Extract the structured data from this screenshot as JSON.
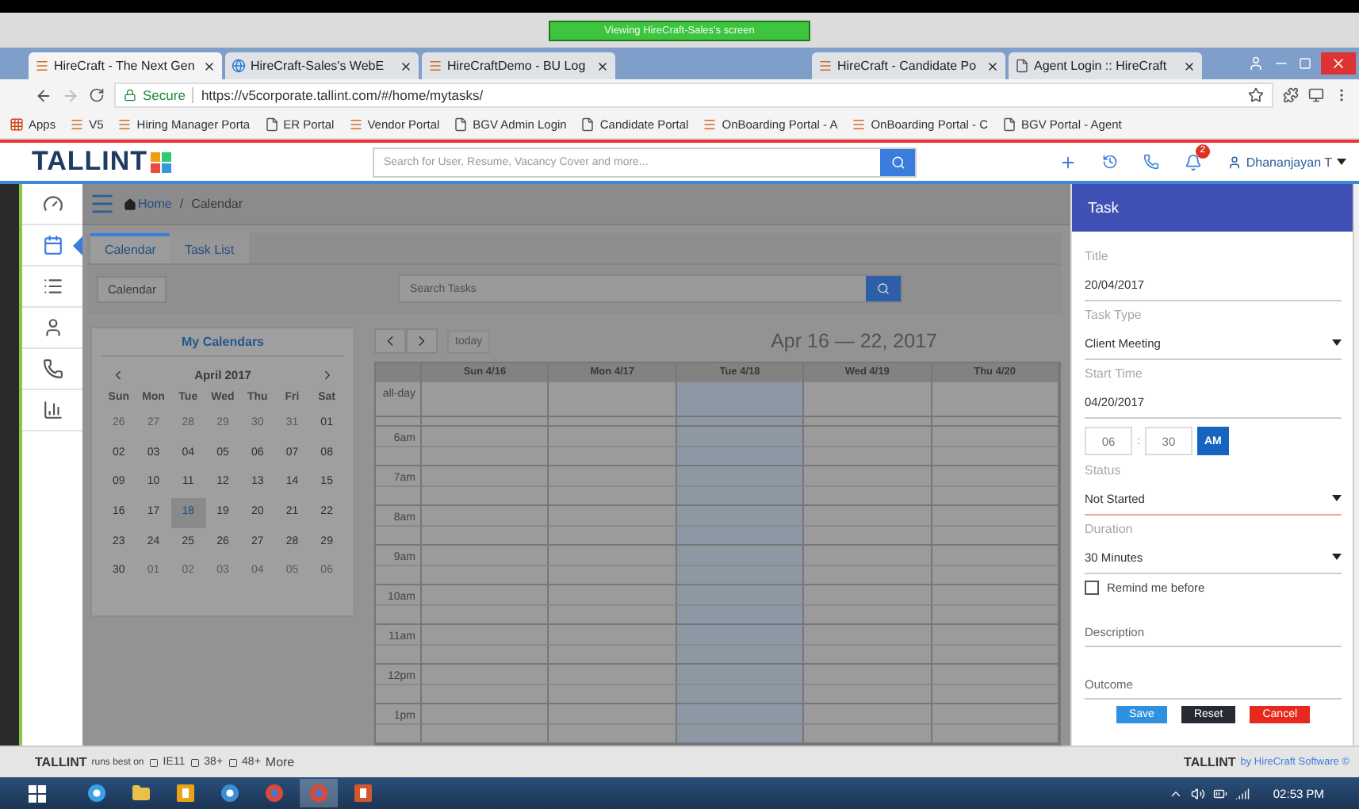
{
  "screen_share": {
    "banner": "Viewing HireCraft-Sales's screen"
  },
  "browser": {
    "tabs": [
      {
        "title": "HireCraft - The Next Gen",
        "kind": "site",
        "selected": true
      },
      {
        "title": "HireCraft-Sales's WebE",
        "kind": "globe",
        "selected": false
      },
      {
        "title": "HireCraftDemo - BU Log",
        "kind": "site",
        "selected": false
      },
      {
        "title": "HireCraft - Candidate Po",
        "kind": "site",
        "selected": false
      },
      {
        "title": "Agent Login :: HireCraft",
        "kind": "page",
        "selected": false
      }
    ],
    "secure_label": "Secure",
    "url": "https://v5corporate.tallint.com/#/home/mytasks/",
    "bookmarks": [
      {
        "label": "Apps",
        "kind": "apps"
      },
      {
        "label": "V5",
        "kind": "site"
      },
      {
        "label": "Hiring Manager Porta",
        "kind": "site"
      },
      {
        "label": "ER Portal",
        "kind": "page"
      },
      {
        "label": "Vendor Portal",
        "kind": "site"
      },
      {
        "label": "BGV Admin Login",
        "kind": "page"
      },
      {
        "label": "Candidate Portal",
        "kind": "page"
      },
      {
        "label": "OnBoarding Portal - A",
        "kind": "site"
      },
      {
        "label": "OnBoarding Portal - C",
        "kind": "site"
      },
      {
        "label": "BGV Portal - Agent",
        "kind": "page"
      }
    ]
  },
  "header": {
    "logo": "TALLINT",
    "search_placeholder": "Search for User, Resume, Vacancy Cover and more...",
    "notification_count": "2",
    "user": "Dhananjayan T"
  },
  "sidebar": {
    "items": [
      {
        "kind": "dashboard",
        "selected": false
      },
      {
        "kind": "calendar",
        "selected": true
      },
      {
        "kind": "list",
        "selected": false
      },
      {
        "kind": "user",
        "selected": false
      },
      {
        "kind": "phone",
        "selected": false
      },
      {
        "kind": "chart",
        "selected": false
      }
    ]
  },
  "breadcrumb": [
    "Home",
    "Calendar"
  ],
  "breadcrumb_separator": "/",
  "tabs": [
    {
      "label": "Calendar",
      "selected": true
    },
    {
      "label": "Task List",
      "selected": false
    }
  ],
  "toolbar": {
    "button": "Calendar",
    "search_placeholder": "Search Tasks"
  },
  "mini_calendar": {
    "title": "My Calendars",
    "month": "April 2017",
    "weekdays": [
      "Sun",
      "Mon",
      "Tue",
      "Wed",
      "Thu",
      "Fri",
      "Sat"
    ],
    "weeks": [
      [
        {
          "label": "26",
          "outside": true,
          "selected": false
        },
        {
          "label": "27",
          "outside": true,
          "selected": false
        },
        {
          "label": "28",
          "outside": true,
          "selected": false
        },
        {
          "label": "29",
          "outside": true,
          "selected": false
        },
        {
          "label": "30",
          "outside": true,
          "selected": false
        },
        {
          "label": "31",
          "outside": true,
          "selected": false
        },
        {
          "label": "01",
          "outside": false,
          "selected": false
        }
      ],
      [
        {
          "label": "02",
          "outside": false,
          "selected": false
        },
        {
          "label": "03",
          "outside": false,
          "selected": false
        },
        {
          "label": "04",
          "outside": false,
          "selected": false
        },
        {
          "label": "05",
          "outside": false,
          "selected": false
        },
        {
          "label": "06",
          "outside": false,
          "selected": false
        },
        {
          "label": "07",
          "outside": false,
          "selected": false
        },
        {
          "label": "08",
          "outside": false,
          "selected": false
        }
      ],
      [
        {
          "label": "09",
          "outside": false,
          "selected": false
        },
        {
          "label": "10",
          "outside": false,
          "selected": false
        },
        {
          "label": "11",
          "outside": false,
          "selected": false
        },
        {
          "label": "12",
          "outside": false,
          "selected": false
        },
        {
          "label": "13",
          "outside": false,
          "selected": false
        },
        {
          "label": "14",
          "outside": false,
          "selected": false
        },
        {
          "label": "15",
          "outside": false,
          "selected": false
        }
      ],
      [
        {
          "label": "16",
          "outside": false,
          "selected": false
        },
        {
          "label": "17",
          "outside": false,
          "selected": false
        },
        {
          "label": "18",
          "outside": false,
          "selected": true
        },
        {
          "label": "19",
          "outside": false,
          "selected": false
        },
        {
          "label": "20",
          "outside": false,
          "selected": false
        },
        {
          "label": "21",
          "outside": false,
          "selected": false
        },
        {
          "label": "22",
          "outside": false,
          "selected": false
        }
      ],
      [
        {
          "label": "23",
          "outside": false,
          "selected": false
        },
        {
          "label": "24",
          "outside": false,
          "selected": false
        },
        {
          "label": "25",
          "outside": false,
          "selected": false
        },
        {
          "label": "26",
          "outside": false,
          "selected": false
        },
        {
          "label": "27",
          "outside": false,
          "selected": false
        },
        {
          "label": "28",
          "outside": false,
          "selected": false
        },
        {
          "label": "29",
          "outside": false,
          "selected": false
        }
      ],
      [
        {
          "label": "30",
          "outside": false,
          "selected": false
        },
        {
          "label": "01",
          "outside": true,
          "selected": false
        },
        {
          "label": "02",
          "outside": true,
          "selected": false
        },
        {
          "label": "03",
          "outside": true,
          "selected": false
        },
        {
          "label": "04",
          "outside": true,
          "selected": false
        },
        {
          "label": "05",
          "outside": true,
          "selected": false
        },
        {
          "label": "06",
          "outside": true,
          "selected": false
        }
      ]
    ]
  },
  "week_view": {
    "today_button": "today",
    "range": "Apr 16 — 22, 2017",
    "all_day": "all-day",
    "days": [
      {
        "label": "Sun 4/16",
        "today": false
      },
      {
        "label": "Mon 4/17",
        "today": false
      },
      {
        "label": "Tue 4/18",
        "today": true
      },
      {
        "label": "Wed 4/19",
        "today": false
      },
      {
        "label": "Thu 4/20",
        "today": false
      }
    ],
    "slots": [
      "6am",
      "7am",
      "8am",
      "9am",
      "10am",
      "11am",
      "12pm",
      "1pm"
    ]
  },
  "task_panel": {
    "title": "Task",
    "fields": [
      {
        "kind": "text",
        "label": "Title",
        "value": "20/04/2017",
        "error": false
      },
      {
        "kind": "select",
        "label": "Task Type",
        "value": "Client Meeting",
        "error": false
      },
      {
        "kind": "text",
        "label": "Start Time",
        "value": "04/20/2017",
        "error": false
      },
      {
        "kind": "time",
        "hour": "06",
        "separator": ":",
        "minute": "30",
        "meridiem": "AM"
      },
      {
        "kind": "select",
        "label": "Status",
        "value": "Not Started",
        "error": true
      },
      {
        "kind": "select",
        "label": "Duration",
        "value": "30 Minutes",
        "error": false
      },
      {
        "kind": "checkbox",
        "label": "Remind me before",
        "checked": false
      },
      {
        "kind": "blank",
        "placeholder": "Description"
      },
      {
        "kind": "blank",
        "placeholder": "Outcome"
      }
    ],
    "buttons": [
      {
        "label": "Save",
        "kind": "primary"
      },
      {
        "label": "Reset",
        "kind": "dark"
      },
      {
        "label": "Cancel",
        "kind": "danger"
      }
    ]
  },
  "footer": {
    "brand": "TALLINT",
    "note": "runs best on",
    "browsers": [
      "IE11",
      "38+",
      "48+"
    ],
    "more": "More",
    "right_brand": "TALLINT",
    "credit": "by HireCraft Software ©"
  },
  "taskbar": {
    "apps": [
      {
        "kind": "ie",
        "selected": false
      },
      {
        "kind": "folder",
        "selected": false
      },
      {
        "kind": "outlook",
        "selected": false
      },
      {
        "kind": "webex",
        "selected": false
      },
      {
        "kind": "chrome",
        "selected": false
      },
      {
        "kind": "chrome",
        "selected": true
      },
      {
        "kind": "powerpoint",
        "selected": false
      }
    ],
    "clock": "02:53 PM"
  }
}
